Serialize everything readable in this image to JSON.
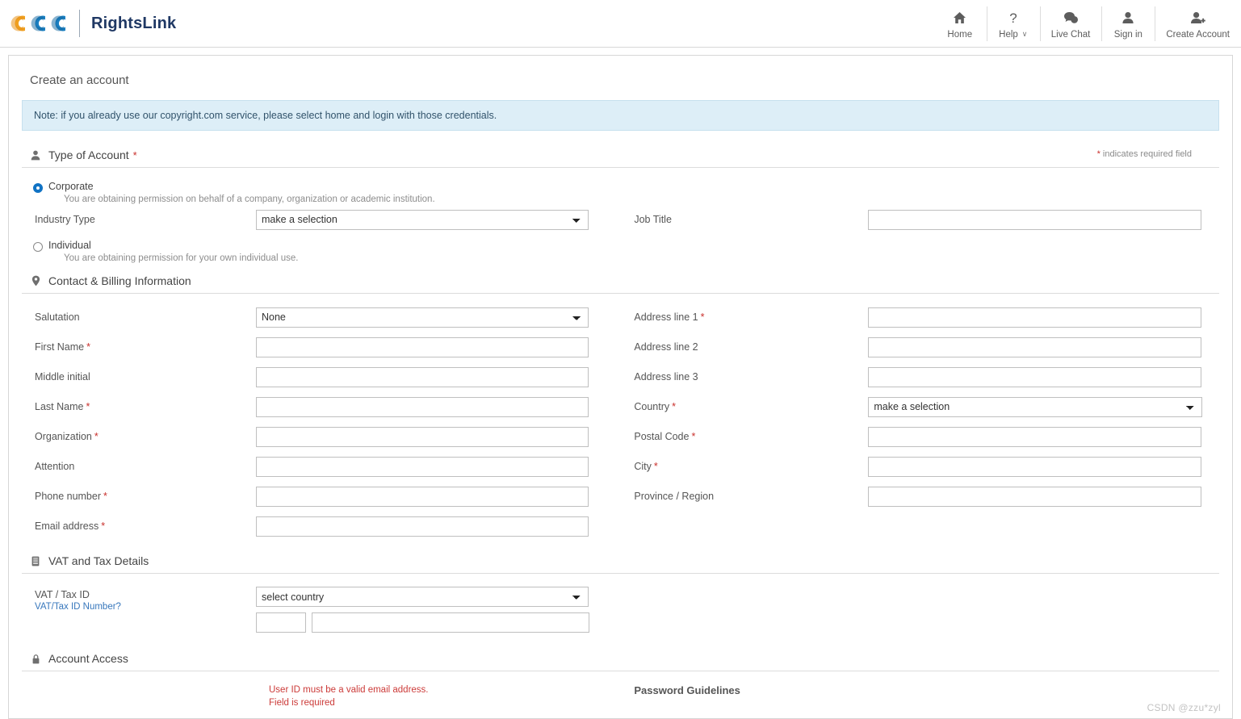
{
  "brand": {
    "logo_alt": "CCC",
    "name": "RightsLink",
    "logo_colors": {
      "c1": "#f0a020",
      "c2": "#1a7fc1",
      "c3": "#1a7fc1"
    }
  },
  "nav": {
    "items": [
      {
        "label": "Home",
        "icon": "home-icon"
      },
      {
        "label": "Help",
        "icon": "question-icon",
        "caret": "∨"
      },
      {
        "label": "Live Chat",
        "icon": "chat-icon"
      },
      {
        "label": "Sign in",
        "icon": "user-icon"
      },
      {
        "label": "Create Account",
        "icon": "user-plus-icon"
      }
    ]
  },
  "page": {
    "title": "Create an account",
    "notice": "Note: if you already use our copyright.com service, please select home and login with those credentials.",
    "required_note_star": "*",
    "required_note_text": " indicates required field",
    "watermark": "CSDN @zzu*zyl"
  },
  "account_type": {
    "section_title": "Type of Account",
    "section_required": "*",
    "options": [
      {
        "label": "Corporate",
        "help": "You are obtaining permission on behalf of a company, organization or academic institution.",
        "selected": true
      },
      {
        "label": "Individual",
        "help": "You are obtaining permission for your own individual use.",
        "selected": false
      }
    ],
    "industry_type_label": "Industry Type",
    "industry_type_value": "make a selection",
    "job_title_label": "Job Title",
    "job_title_value": ""
  },
  "contact": {
    "section_title": "Contact & Billing Information",
    "left_fields": [
      {
        "label": "Salutation",
        "required": false,
        "type": "select",
        "value": "None"
      },
      {
        "label": "First Name",
        "required": true,
        "type": "text",
        "value": ""
      },
      {
        "label": "Middle initial",
        "required": false,
        "type": "text",
        "value": ""
      },
      {
        "label": "Last Name",
        "required": true,
        "type": "text",
        "value": ""
      },
      {
        "label": "Organization",
        "required": true,
        "type": "text",
        "value": ""
      },
      {
        "label": "Attention",
        "required": false,
        "type": "text",
        "value": ""
      },
      {
        "label": "Phone number",
        "required": true,
        "type": "text",
        "value": ""
      },
      {
        "label": "Email address",
        "required": true,
        "type": "text",
        "value": ""
      }
    ],
    "right_fields": [
      {
        "label": "Address line 1",
        "required": true,
        "type": "text",
        "value": ""
      },
      {
        "label": "Address line 2",
        "required": false,
        "type": "text",
        "value": ""
      },
      {
        "label": "Address line 3",
        "required": false,
        "type": "text",
        "value": ""
      },
      {
        "label": "Country",
        "required": true,
        "type": "select",
        "value": "make a selection"
      },
      {
        "label": "Postal Code",
        "required": true,
        "type": "text",
        "value": ""
      },
      {
        "label": "City",
        "required": true,
        "type": "text",
        "value": ""
      },
      {
        "label": "Province / Region",
        "required": false,
        "type": "text",
        "value": ""
      }
    ]
  },
  "vat": {
    "section_title": "VAT and Tax Details",
    "label": "VAT / Tax ID",
    "link": "VAT/Tax ID Number?",
    "country_value": "select country",
    "prefix_value": "",
    "id_value": ""
  },
  "account_access": {
    "section_title": "Account Access",
    "error_line1": "User ID must be a valid email address.",
    "error_line2": "Field is required",
    "password_guidelines": "Password Guidelines"
  }
}
